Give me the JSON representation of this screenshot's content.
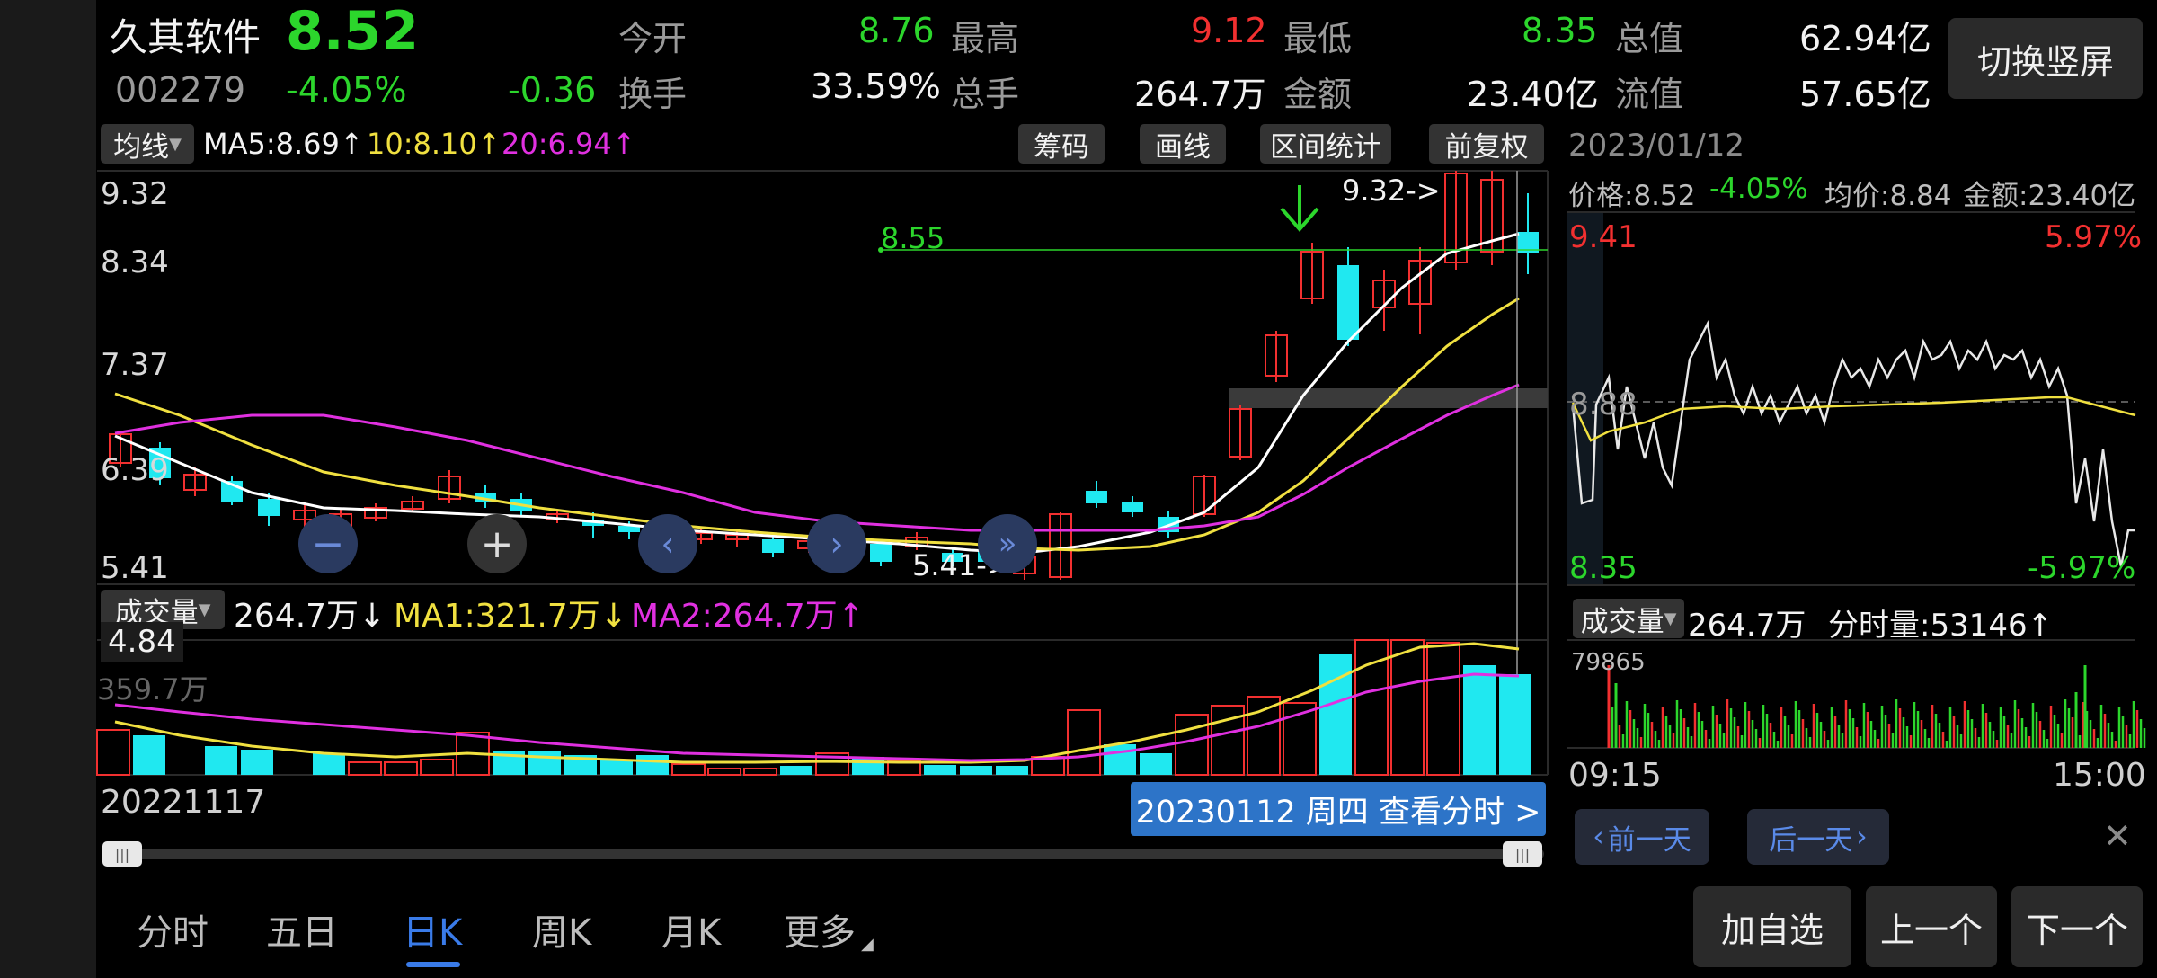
{
  "header": {
    "stock_name": "久其软件",
    "price": "8.52",
    "code": "002279",
    "change_pct": "-4.05%",
    "change": "-0.36",
    "switch_btn": "切换竖屏"
  },
  "quote": {
    "open_label": "今开",
    "open": "8.76",
    "high_label": "最高",
    "high": "9.12",
    "low_label": "最低",
    "low": "8.35",
    "mktcap_label": "总值",
    "mktcap": "62.94亿",
    "turnover_label": "换手",
    "turnover": "33.59%",
    "vol_label": "总手",
    "vol": "264.7万",
    "amount_label": "金额",
    "amount": "23.40亿",
    "float_label": "流值",
    "float": "57.65亿"
  },
  "ma_bar": {
    "type_label": "均线",
    "ma5": "MA5:8.69↑",
    "ma10": "10:8.10↑",
    "ma20": "20:6.94↑",
    "chips": "筹码",
    "draw": "画线",
    "range": "区间统计",
    "adjust": "前复权"
  },
  "price_axis": {
    "t1": "9.32",
    "t2": "8.34",
    "t3": "7.37",
    "t4": "6.39",
    "t5": "5.41"
  },
  "price_annotations": {
    "line_value": "8.55",
    "high_mark": "9.32->",
    "low_mark": "5.41->"
  },
  "vol_bar": {
    "label": "成交量",
    "vol": "264.7万↓",
    "ma1": "MA1:321.7万↓",
    "ma2": "MA2:264.7万↑",
    "cursor_value": "4.84",
    "max_partial": "359.7万"
  },
  "dates": {
    "start": "20221117",
    "selected": "20230112 周四 查看分时 >"
  },
  "intraday": {
    "date": "2023/01/12",
    "price": "价格:8.52",
    "pct": "-4.05%",
    "avg": "均价:8.84",
    "amount": "金额:23.40亿",
    "top_price": "9.41",
    "top_pct": "5.97%",
    "mid": "8.88",
    "bottom_price": "8.35",
    "bottom_pct": "-5.97%",
    "vol_label": "成交量",
    "vol": "264.7万",
    "tick_vol": "分时量:53146↑",
    "vol_max": "79865",
    "t_start": "09:15",
    "t_end": "15:00",
    "prev_day": "前一天",
    "next_day": "后一天"
  },
  "tabs": {
    "t1": "分时",
    "t2": "五日",
    "t3": "日K",
    "t4": "周K",
    "t5": "月K",
    "t6": "更多"
  },
  "actions": {
    "add": "加自选",
    "prev": "上一个",
    "next": "下一个"
  },
  "colors": {
    "up": "#f23030",
    "down": "#20e8f0",
    "ma5": "#ffffff",
    "ma10": "#f0e040",
    "ma20": "#e030e0",
    "tab_active": "#3a7be8"
  }
}
